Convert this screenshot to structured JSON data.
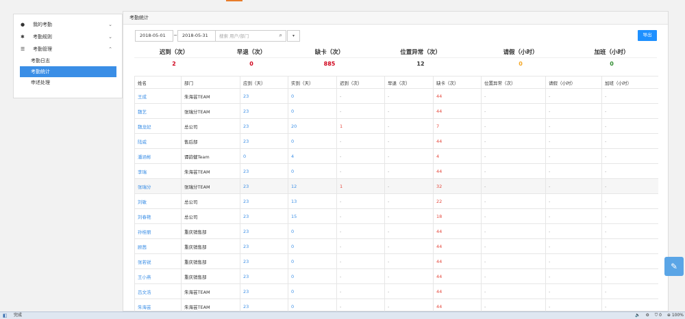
{
  "sidebar": {
    "items": [
      {
        "label": "我的考勤",
        "icon": "user-icon",
        "glyph": "●",
        "chevron": "⌄"
      },
      {
        "label": "考勤规则",
        "icon": "gear-icon",
        "glyph": "✱",
        "chevron": "⌄"
      },
      {
        "label": "考勤管理",
        "icon": "list-icon",
        "glyph": "☰",
        "chevron": "⌃"
      }
    ],
    "subitems": [
      {
        "label": "考勤日志"
      },
      {
        "label": "考勤统计"
      },
      {
        "label": "申述处理"
      }
    ]
  },
  "panel": {
    "title": "考勤统计"
  },
  "filters": {
    "start_date": "2018-05-01",
    "separator": "~",
    "end_date": "2018-05-31",
    "search_placeholder": "搜索 用户/部门",
    "search_glyph": "⌕",
    "dropdown_glyph": "▾"
  },
  "toolbar": {
    "export_label": "导出"
  },
  "summary": [
    {
      "label": "迟到（次）",
      "value": "2",
      "color": "#d0021b"
    },
    {
      "label": "早退（次）",
      "value": "0",
      "color": "#d0021b"
    },
    {
      "label": "缺卡（次）",
      "value": "885",
      "color": "#d0021b"
    },
    {
      "label": "位置异常（次）",
      "value": "12",
      "color": "#333333"
    },
    {
      "label": "请假（小时）",
      "value": "0",
      "color": "#f5a623"
    },
    {
      "label": "加班（小时）",
      "value": "0",
      "color": "#2e8b2e"
    }
  ],
  "table": {
    "headers": [
      "姓名",
      "部门",
      "应到（天）",
      "实到（天）",
      "迟到（次）",
      "早退（次）",
      "缺卡（次）",
      "位置异常（次）",
      "请假（小时）",
      "加班（小时）"
    ],
    "rows": [
      [
        "王成",
        "朱海芸TEAM",
        "23",
        "0",
        "-",
        "-",
        "44",
        "-",
        "-",
        "-"
      ],
      [
        "魏艺",
        "张瑞分TEAM",
        "23",
        "0",
        "-",
        "-",
        "44",
        "-",
        "-",
        "-"
      ],
      [
        "魏龙妃",
        "总公司",
        "23",
        "20",
        "1",
        "-",
        "7",
        "-",
        "-",
        "-"
      ],
      [
        "陆威",
        "售后部",
        "23",
        "0",
        "-",
        "-",
        "44",
        "-",
        "-",
        "-"
      ],
      [
        "潘涵彬",
        "谭韵健Team",
        "0",
        "4",
        "-",
        "-",
        "4",
        "-",
        "-",
        "-"
      ],
      [
        "李瑞",
        "朱海芸TEAM",
        "23",
        "0",
        "-",
        "-",
        "44",
        "-",
        "-",
        "-"
      ],
      [
        "张瑞分",
        "张瑞分TEAM",
        "23",
        "12",
        "1",
        "-",
        "32",
        "-",
        "-",
        "-"
      ],
      [
        "刘敏",
        "总公司",
        "23",
        "13",
        "-",
        "-",
        "22",
        "-",
        "-",
        "-"
      ],
      [
        "刘春艳",
        "总公司",
        "23",
        "15",
        "-",
        "-",
        "18",
        "-",
        "-",
        "-"
      ],
      [
        "孙桂丽",
        "重庆销售部",
        "23",
        "0",
        "-",
        "-",
        "44",
        "-",
        "-",
        "-"
      ],
      [
        "顾茜",
        "重庆销售部",
        "23",
        "0",
        "-",
        "-",
        "44",
        "-",
        "-",
        "-"
      ],
      [
        "张若锐",
        "重庆销售部",
        "23",
        "0",
        "-",
        "-",
        "44",
        "-",
        "-",
        "-"
      ],
      [
        "王小燕",
        "重庆销售部",
        "23",
        "0",
        "-",
        "-",
        "44",
        "-",
        "-",
        "-"
      ],
      [
        "吕文浩",
        "朱海芸TEAM",
        "23",
        "0",
        "-",
        "-",
        "44",
        "-",
        "-",
        "-"
      ],
      [
        "朱海芸",
        "朱海芸TEAM",
        "23",
        "0",
        "-",
        "-",
        "44",
        "-",
        "-",
        "-"
      ]
    ],
    "highlighted_row": 6
  },
  "float_button": {
    "icon": "edit-icon",
    "glyph": "✎"
  },
  "statusbar": {
    "text": "完成",
    "glyph": "◧",
    "right": [
      "🔈",
      "⚙",
      "⛉ 0",
      "⊕ 100%"
    ]
  },
  "colors": {
    "accent": "#3a8ee6",
    "red": "#e5463a",
    "export": "#1e90ff"
  }
}
